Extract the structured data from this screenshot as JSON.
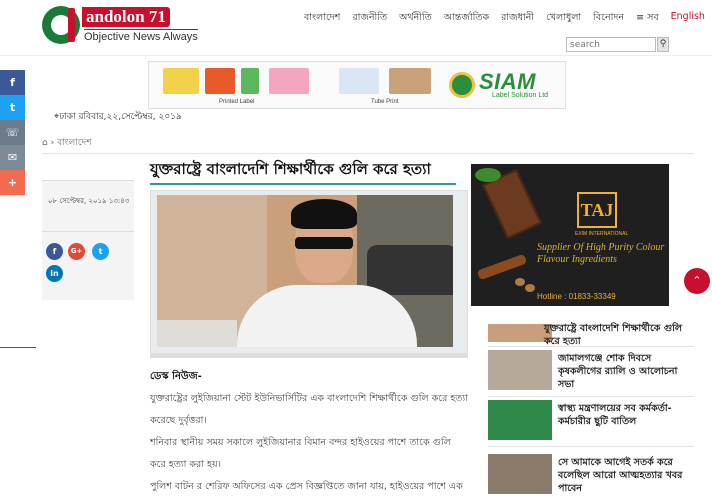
{
  "brand": {
    "logo_name": "andolon 71",
    "tagline": "Objective News Always"
  },
  "nav": {
    "items": [
      "বাংলাদেশ",
      "রাজনীতি",
      "অর্থনীতি",
      "আন্তর্জাতিক",
      "রাজধানী",
      "খেলাধুলা",
      "বিনোদন",
      "≡ সব"
    ],
    "language": "English"
  },
  "search": {
    "placeholder": "search"
  },
  "banner": {
    "caption_1": "Printed Label",
    "caption_2": "Tube Print",
    "company": "SIAM",
    "company_sub": "Label Solution Ltd"
  },
  "dateline": "ঢাকা রবিবার,২২,সেপ্টেম্বর, ২০১৯",
  "breadcrumb": {
    "home_icon": "home-icon",
    "section": "বাংলাদেশ"
  },
  "article": {
    "timestamp": "০৮ সেপ্টেম্বর, ২০১৯ ১৩:৪৩",
    "title": "যুক্তরাষ্ট্রে বাংলাদেশি শিক্ষার্থীকে গুলি করে হত্যা",
    "kicker": "ডেস্ক নিউজ-",
    "paragraphs": [
      "যুক্তরাষ্ট্রের লুইজিয়ানা স্টেট ইউনিভার্সিটির এক বাংলাদেশি শিক্ষার্থীকে গুলি করে হত্যা করেছে দুর্বৃত্তরা।",
      "শনিবার স্থানীয় সময় সকালে লুইজিয়ানার বিমান বন্দর হাইওয়ের পাশে তাকে গুলি করে হত্যা করা হয়।",
      "পুলিশ বাটন র শেরিফ অফিসের এক প্রেস বিজ্ঞপ্তিতে জানা যায়, হাইওয়ের পাশে এক গ্যাস"
    ]
  },
  "share_buttons": [
    "f",
    "G+",
    "t",
    "in"
  ],
  "social_sidebar": [
    "f",
    "t",
    "☏",
    "✉",
    "+"
  ],
  "right_ad": {
    "logo": "TAJ",
    "brand": "EXIM INTERNATIONAL",
    "text": "Supplier Of High Purity Colour Flavour Ingredients",
    "hotline": "Hotline : 01833-33349"
  },
  "related": [
    {
      "title": "যুক্তরাষ্ট্রে বাংলাদেশি শিক্ষার্থীকে গুলি করে হত্যা"
    },
    {
      "title": "জামালগঞ্জে শোক দিবসে কৃষকলীগের র‍্যালি ও আলোচনা সভা"
    },
    {
      "title": "স্বাস্থ্য মন্ত্রণালয়ের সব কর্মকর্তা-কর্মচারীর ছুটি বাতিল"
    },
    {
      "title": "সে আমাকে আগেই সতর্ক করে বলেছিল আরো আত্মহত্যার খবর পাবেন"
    }
  ],
  "colors": {
    "brand_red": "#c8102e",
    "brand_green": "#1a7a3a",
    "title_rule": "#2a9aa0"
  }
}
